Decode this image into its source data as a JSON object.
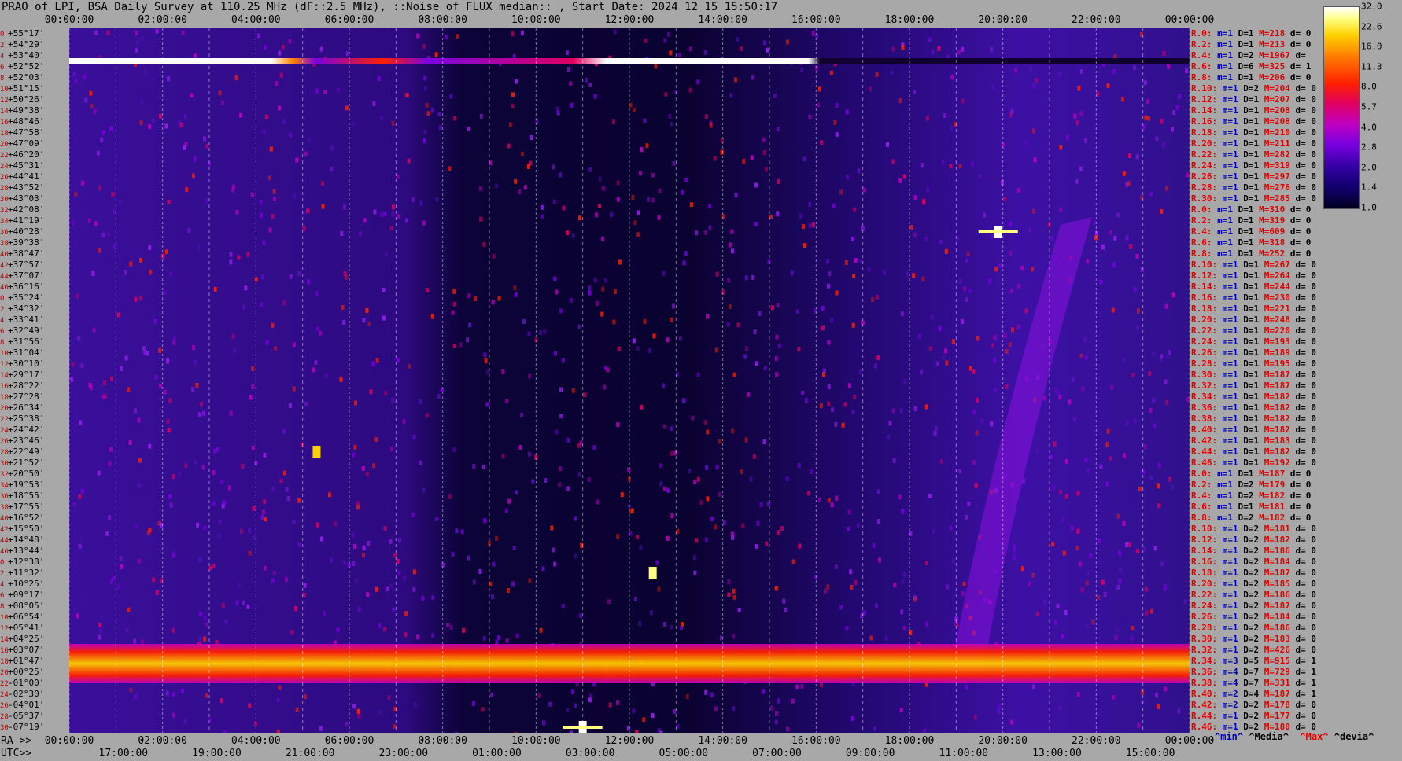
{
  "title": "PRAO of LPI, BSA Daily Survey at 110.25 MHz (dF::2.5 MHz), ::Noise_of_FLUX_median:: , Start Date: 2024 12 15 15:50:17",
  "ra_prefix": "RA >>",
  "utc_prefix": "UTC>>",
  "top_ticks": [
    "00:00:00",
    "02:00:00",
    "04:00:00",
    "06:00:00",
    "08:00:00",
    "10:00:00",
    "12:00:00",
    "14:00:00",
    "16:00:00",
    "18:00:00",
    "20:00:00",
    "22:00:00",
    "00:00:00"
  ],
  "ra_ticks": [
    "00:00:00",
    "02:00:00",
    "04:00:00",
    "06:00:00",
    "08:00:00",
    "10:00:00",
    "12:00:00",
    "14:00:00",
    "16:00:00",
    "18:00:00",
    "20:00:00",
    "22:00:00",
    "00:00:00"
  ],
  "utc_ticks": [
    "17:00:00",
    "19:00:00",
    "21:00:00",
    "23:00:00",
    "01:00:00",
    "03:00:00",
    "05:00:00",
    "07:00:00",
    "09:00:00",
    "11:00:00",
    "13:00:00",
    "15:00:00"
  ],
  "dec_labels": [
    "+55°17'",
    "+54°29'",
    "+53°40'",
    "+52°52'",
    "+52°03'",
    "+51°15'",
    "+50°26'",
    "+49°38'",
    "+48°46'",
    "+47°58'",
    "+47°09'",
    "+46°20'",
    "+45°31'",
    "+44°41'",
    "+43°52'",
    "+43°03'",
    "+42°08'",
    "+41°19'",
    "+40°28'",
    "+39°38'",
    "+38°47'",
    "+37°57'",
    "+37°07'",
    "+36°16'",
    "+35°24'",
    "+34°32'",
    "+33°41'",
    "+32°49'",
    "+31°56'",
    "+31°04'",
    "+30°10'",
    "+29°17'",
    "+28°22'",
    "+27°28'",
    "+26°34'",
    "+25°38'",
    "+24°42'",
    "+23°46'",
    "+22°49'",
    "+21°52'",
    "+20°50'",
    "+19°53'",
    "+18°55'",
    "+17°55'",
    "+16°52'",
    "+15°50'",
    "+14°48'",
    "+13°44'",
    "+12°38'",
    "+11°32'",
    "+10°25'",
    "+09°17'",
    "+08°05'",
    "+06°54'",
    "+05°41'",
    "+04°25'",
    "+03°07'",
    "+01°47'",
    "+00°25'",
    "-01°00'",
    "-02°30'",
    "-04°01'",
    "-05°37'",
    "-07°19'"
  ],
  "dec_indices": [
    "0",
    "2",
    "4",
    "6",
    "8",
    "10",
    "12",
    "14",
    "16",
    "18",
    "20",
    "22",
    "24",
    "26",
    "28",
    "30",
    "32",
    "34",
    "36",
    "38",
    "40",
    "42",
    "44",
    "46",
    "0",
    "2",
    "4",
    "6",
    "8",
    "10",
    "12",
    "14",
    "16",
    "18",
    "20",
    "22",
    "24",
    "26",
    "28",
    "30",
    "32",
    "34",
    "36",
    "38",
    "40",
    "42",
    "44",
    "46",
    "0",
    "2",
    "4",
    "6",
    "8",
    "10",
    "12",
    "14",
    "16",
    "18",
    "20",
    "22",
    "24",
    "26",
    "28",
    "30"
  ],
  "stats": [
    {
      "r": "R.0:",
      "m": "m=1",
      "d": "D=1",
      "mx": "M=218",
      "dv": "d= 0"
    },
    {
      "r": "R.2:",
      "m": "m=1",
      "d": "D=1",
      "mx": "M=213",
      "dv": "d= 0"
    },
    {
      "r": "R.4:",
      "m": "m=1",
      "d": "D=2",
      "mx": "M=1967",
      "dv": "d="
    },
    {
      "r": "R.6:",
      "m": "m=1",
      "d": "D=6",
      "mx": "M=325",
      "dv": "d= 1"
    },
    {
      "r": "R.8:",
      "m": "m=1",
      "d": "D=1",
      "mx": "M=206",
      "dv": "d= 0"
    },
    {
      "r": "R.10:",
      "m": "m=1",
      "d": "D=2",
      "mx": "M=204",
      "dv": "d= 0"
    },
    {
      "r": "R.12:",
      "m": "m=1",
      "d": "D=1",
      "mx": "M=207",
      "dv": "d= 0"
    },
    {
      "r": "R.14:",
      "m": "m=1",
      "d": "D=1",
      "mx": "M=208",
      "dv": "d= 0"
    },
    {
      "r": "R.16:",
      "m": "m=1",
      "d": "D=1",
      "mx": "M=208",
      "dv": "d= 0"
    },
    {
      "r": "R.18:",
      "m": "m=1",
      "d": "D=1",
      "mx": "M=210",
      "dv": "d= 0"
    },
    {
      "r": "R.20:",
      "m": "m=1",
      "d": "D=1",
      "mx": "M=211",
      "dv": "d= 0"
    },
    {
      "r": "R.22:",
      "m": "m=1",
      "d": "D=1",
      "mx": "M=282",
      "dv": "d= 0"
    },
    {
      "r": "R.24:",
      "m": "m=1",
      "d": "D=1",
      "mx": "M=319",
      "dv": "d= 0"
    },
    {
      "r": "R.26:",
      "m": "m=1",
      "d": "D=1",
      "mx": "M=297",
      "dv": "d= 0"
    },
    {
      "r": "R.28:",
      "m": "m=1",
      "d": "D=1",
      "mx": "M=276",
      "dv": "d= 0"
    },
    {
      "r": "R.30:",
      "m": "m=1",
      "d": "D=1",
      "mx": "M=285",
      "dv": "d= 0"
    },
    {
      "r": "R.0:",
      "m": "m=1",
      "d": "D=1",
      "mx": "M=310",
      "dv": "d= 0"
    },
    {
      "r": "R.2:",
      "m": "m=1",
      "d": "D=1",
      "mx": "M=319",
      "dv": "d= 0"
    },
    {
      "r": "R.4:",
      "m": "m=1",
      "d": "D=1",
      "mx": "M=609",
      "dv": "d= 0"
    },
    {
      "r": "R.6:",
      "m": "m=1",
      "d": "D=1",
      "mx": "M=318",
      "dv": "d= 0"
    },
    {
      "r": "R.8:",
      "m": "m=1",
      "d": "D=1",
      "mx": "M=252",
      "dv": "d= 0"
    },
    {
      "r": "R.10:",
      "m": "m=1",
      "d": "D=1",
      "mx": "M=267",
      "dv": "d= 0"
    },
    {
      "r": "R.12:",
      "m": "m=1",
      "d": "D=1",
      "mx": "M=264",
      "dv": "d= 0"
    },
    {
      "r": "R.14:",
      "m": "m=1",
      "d": "D=1",
      "mx": "M=244",
      "dv": "d= 0"
    },
    {
      "r": "R.16:",
      "m": "m=1",
      "d": "D=1",
      "mx": "M=230",
      "dv": "d= 0"
    },
    {
      "r": "R.18:",
      "m": "m=1",
      "d": "D=1",
      "mx": "M=221",
      "dv": "d= 0"
    },
    {
      "r": "R.20:",
      "m": "m=1",
      "d": "D=1",
      "mx": "M=248",
      "dv": "d= 0"
    },
    {
      "r": "R.22:",
      "m": "m=1",
      "d": "D=1",
      "mx": "M=220",
      "dv": "d= 0"
    },
    {
      "r": "R.24:",
      "m": "m=1",
      "d": "D=1",
      "mx": "M=193",
      "dv": "d= 0"
    },
    {
      "r": "R.26:",
      "m": "m=1",
      "d": "D=1",
      "mx": "M=189",
      "dv": "d= 0"
    },
    {
      "r": "R.28:",
      "m": "m=1",
      "d": "D=1",
      "mx": "M=195",
      "dv": "d= 0"
    },
    {
      "r": "R.30:",
      "m": "m=1",
      "d": "D=1",
      "mx": "M=187",
      "dv": "d= 0"
    },
    {
      "r": "R.32:",
      "m": "m=1",
      "d": "D=1",
      "mx": "M=187",
      "dv": "d= 0"
    },
    {
      "r": "R.34:",
      "m": "m=1",
      "d": "D=1",
      "mx": "M=182",
      "dv": "d= 0"
    },
    {
      "r": "R.36:",
      "m": "m=1",
      "d": "D=1",
      "mx": "M=182",
      "dv": "d= 0"
    },
    {
      "r": "R.38:",
      "m": "m=1",
      "d": "D=1",
      "mx": "M=182",
      "dv": "d= 0"
    },
    {
      "r": "R.40:",
      "m": "m=1",
      "d": "D=1",
      "mx": "M=182",
      "dv": "d= 0"
    },
    {
      "r": "R.42:",
      "m": "m=1",
      "d": "D=1",
      "mx": "M=183",
      "dv": "d= 0"
    },
    {
      "r": "R.44:",
      "m": "m=1",
      "d": "D=1",
      "mx": "M=182",
      "dv": "d= 0"
    },
    {
      "r": "R.46:",
      "m": "m=1",
      "d": "D=1",
      "mx": "M=192",
      "dv": "d= 0"
    },
    {
      "r": "R.0:",
      "m": "m=1",
      "d": "D=1",
      "mx": "M=187",
      "dv": "d= 0"
    },
    {
      "r": "R.2:",
      "m": "m=1",
      "d": "D=2",
      "mx": "M=179",
      "dv": "d= 0"
    },
    {
      "r": "R.4:",
      "m": "m=1",
      "d": "D=2",
      "mx": "M=182",
      "dv": "d= 0"
    },
    {
      "r": "R.6:",
      "m": "m=1",
      "d": "D=1",
      "mx": "M=181",
      "dv": "d= 0"
    },
    {
      "r": "R.8:",
      "m": "m=1",
      "d": "D=2",
      "mx": "M=182",
      "dv": "d= 0"
    },
    {
      "r": "R.10:",
      "m": "m=1",
      "d": "D=2",
      "mx": "M=181",
      "dv": "d= 0"
    },
    {
      "r": "R.12:",
      "m": "m=1",
      "d": "D=2",
      "mx": "M=182",
      "dv": "d= 0"
    },
    {
      "r": "R.14:",
      "m": "m=1",
      "d": "D=2",
      "mx": "M=186",
      "dv": "d= 0"
    },
    {
      "r": "R.16:",
      "m": "m=1",
      "d": "D=2",
      "mx": "M=184",
      "dv": "d= 0"
    },
    {
      "r": "R.18:",
      "m": "m=1",
      "d": "D=2",
      "mx": "M=187",
      "dv": "d= 0"
    },
    {
      "r": "R.20:",
      "m": "m=1",
      "d": "D=2",
      "mx": "M=185",
      "dv": "d= 0"
    },
    {
      "r": "R.22:",
      "m": "m=1",
      "d": "D=2",
      "mx": "M=186",
      "dv": "d= 0"
    },
    {
      "r": "R.24:",
      "m": "m=1",
      "d": "D=2",
      "mx": "M=187",
      "dv": "d= 0"
    },
    {
      "r": "R.26:",
      "m": "m=1",
      "d": "D=2",
      "mx": "M=184",
      "dv": "d= 0"
    },
    {
      "r": "R.28:",
      "m": "m=1",
      "d": "D=2",
      "mx": "M=186",
      "dv": "d= 0"
    },
    {
      "r": "R.30:",
      "m": "m=1",
      "d": "D=2",
      "mx": "M=183",
      "dv": "d= 0"
    },
    {
      "r": "R.32:",
      "m": "m=1",
      "d": "D=2",
      "mx": "M=426",
      "dv": "d= 0"
    },
    {
      "r": "R.34:",
      "m": "m=3",
      "d": "D=5",
      "mx": "M=915",
      "dv": "d= 1"
    },
    {
      "r": "R.36:",
      "m": "m=4",
      "d": "D=7",
      "mx": "M=729",
      "dv": "d= 1"
    },
    {
      "r": "R.38:",
      "m": "m=4",
      "d": "D=7",
      "mx": "M=331",
      "dv": "d= 1"
    },
    {
      "r": "R.40:",
      "m": "m=2",
      "d": "D=4",
      "mx": "M=187",
      "dv": "d= 1"
    },
    {
      "r": "R.42:",
      "m": "m=2",
      "d": "D=2",
      "mx": "M=178",
      "dv": "d= 0"
    },
    {
      "r": "R.44:",
      "m": "m=1",
      "d": "D=2",
      "mx": "M=177",
      "dv": "d= 0"
    },
    {
      "r": "R.46:",
      "m": "m=1",
      "d": "D=2",
      "mx": "M=180",
      "dv": "d= 0"
    }
  ],
  "legend": {
    "min": "^min^",
    "median": "^Media^",
    "max": "^Max^",
    "devia": "^devia^"
  },
  "colors": {
    "background": "#a8a8a8",
    "stat_name": "#e00000",
    "stat_min": "#0000b0",
    "stat_max": "#e00000"
  },
  "chart_data": {
    "type": "heatmap",
    "x_ticks_ra": [
      "00:00:00",
      "02:00:00",
      "04:00:00",
      "06:00:00",
      "08:00:00",
      "10:00:00",
      "12:00:00",
      "14:00:00",
      "16:00:00",
      "18:00:00",
      "20:00:00",
      "22:00:00",
      "00:00:00"
    ],
    "x_ticks_utc": [
      "17:00:00",
      "19:00:00",
      "21:00:00",
      "23:00:00",
      "01:00:00",
      "03:00:00",
      "05:00:00",
      "07:00:00",
      "09:00:00",
      "11:00:00",
      "13:00:00",
      "15:00:00"
    ],
    "colorbar_ticks": [
      "32.0",
      "22.6",
      "16.0",
      "11.3",
      "8.0",
      "5.7",
      "4.0",
      "2.8",
      "2.0",
      "1.4",
      "1.0"
    ],
    "colorbar_range": [
      1.0,
      32.0
    ],
    "colorbar_scale": "log",
    "ra_range_hours": [
      0,
      24
    ],
    "y_axis": "declination",
    "features": [
      {
        "label": "bright horizontal row",
        "dec": "+52°52'",
        "ra_hours": [
          0,
          16.7
        ],
        "level": 32
      },
      {
        "label": "bright horizontal band",
        "dec": "-01°00'",
        "ra_hours": [
          0,
          24
        ],
        "level": 16
      },
      {
        "label": "bright point source",
        "dec": "+40°28'",
        "ra_hours": 19.9,
        "level": 32
      },
      {
        "label": "bright point source",
        "dec": "-07°19'",
        "ra_hours": 11.0,
        "level": 32
      },
      {
        "label": "bright point source",
        "dec": "+11°32'",
        "ra_hours": 12.5,
        "level": 22.6
      },
      {
        "label": "bright point source",
        "dec": "+22°49'",
        "ra_hours": 5.3,
        "level": 16
      }
    ]
  }
}
